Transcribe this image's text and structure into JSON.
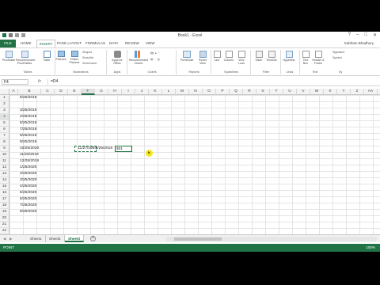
{
  "window": {
    "title": "Book1 - Excel",
    "user": "Subham Bhadhury"
  },
  "tabs": [
    {
      "label": "FILE"
    },
    {
      "label": "HOME"
    },
    {
      "label": "INSERT"
    },
    {
      "label": "PAGE LAYOUT"
    },
    {
      "label": "FORMULAS"
    },
    {
      "label": "DATA"
    },
    {
      "label": "REVIEW"
    },
    {
      "label": "VIEW"
    }
  ],
  "ribbon": {
    "buttons": [
      {
        "label": "PivotTable"
      },
      {
        "label": "Recommended PivotTables"
      },
      {
        "label": "Table"
      },
      {
        "label": "Pictures"
      },
      {
        "label": "Online Pictures"
      },
      {
        "label": "Apps for Office"
      },
      {
        "label": "Recommended Charts"
      },
      {
        "label": "PivotChart"
      },
      {
        "label": "Power View"
      },
      {
        "label": "Line"
      },
      {
        "label": "Column"
      },
      {
        "label": "Win/ Loss"
      },
      {
        "label": "Slicer"
      },
      {
        "label": "Timeline"
      },
      {
        "label": "Hyperlink"
      },
      {
        "label": "Text Box"
      },
      {
        "label": "Header & Footer"
      }
    ],
    "small_items": [
      "Shapes",
      "SmartArt",
      "Screenshot",
      "Signature",
      "Symbol"
    ],
    "groups": [
      {
        "label": "Tables"
      },
      {
        "label": "Illustrations"
      },
      {
        "label": "Apps"
      },
      {
        "label": "Charts"
      },
      {
        "label": "Reports"
      },
      {
        "label": "Sparklines"
      },
      {
        "label": "Filter"
      },
      {
        "label": "Links"
      },
      {
        "label": "Text"
      },
      {
        "label": "Sy"
      }
    ]
  },
  "formula_bar": {
    "name_box": "F4",
    "fx": "fx",
    "formula": "=D4"
  },
  "columns": [
    "A",
    "B",
    "C",
    "D",
    "E",
    "F",
    "G",
    "H",
    "I",
    "J",
    "K",
    "L",
    "M",
    "N",
    "O",
    "P",
    "Q",
    "R",
    "S",
    "T",
    "U",
    "V",
    "W",
    "X",
    "Y",
    "Z",
    "AA",
    "AB"
  ],
  "rows": [
    "1",
    "2",
    "3",
    "4",
    "5",
    "6",
    "7",
    "8",
    "9",
    "10",
    "11",
    "12",
    "13",
    "14",
    "15",
    "16",
    "17",
    "18",
    "19",
    "20",
    "21",
    "22",
    "23"
  ],
  "cells": {
    "col_b": [
      "5/25/2019",
      "",
      "3/25/2019",
      "4/25/2019",
      "5/25/2019",
      "7/25/2019",
      "8/25/2019",
      "9/25/2019",
      "10/25/2019",
      "11/25/2019",
      "12/25/2019",
      "1/25/2020",
      "2/25/2020",
      "3/25/2020",
      "4/25/2020",
      "5/25/2020",
      "6/25/2020",
      "7/25/2020",
      "8/25/2020"
    ],
    "d4": "11/27/1984",
    "e4": "5/25/2019",
    "f4": "931"
  },
  "sheets": [
    {
      "label": "Sheet1"
    },
    {
      "label": "Sheet2"
    },
    {
      "label": "Sheet3"
    }
  ],
  "status": {
    "ready": "POINT",
    "zoom": "100%"
  }
}
